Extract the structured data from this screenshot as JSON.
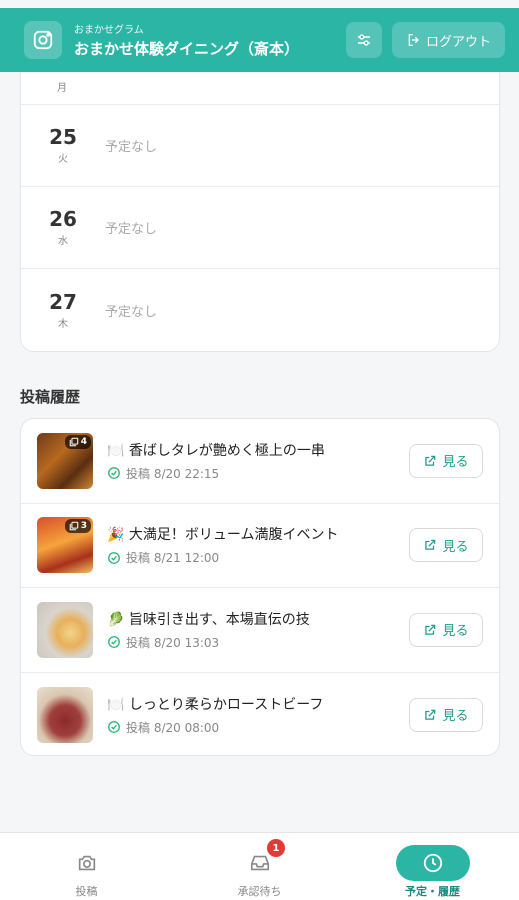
{
  "header": {
    "subtitle": "おまかせグラム",
    "title": "おまかせ体験ダイニング（斎本）",
    "logout_label": "ログアウト"
  },
  "calendar": {
    "partial_weekday": "月",
    "days": [
      {
        "day": "25",
        "weekday": "火",
        "status": "予定なし"
      },
      {
        "day": "26",
        "weekday": "水",
        "status": "予定なし"
      },
      {
        "day": "27",
        "weekday": "木",
        "status": "予定なし"
      }
    ]
  },
  "history": {
    "title": "投稿履歴",
    "view_label": "見る",
    "posts": [
      {
        "emoji": "🍽️",
        "title": "香ばしタレが艶めく極上の一串",
        "meta": "投稿 8/20 22:15",
        "image_count": "4"
      },
      {
        "emoji": "🎉",
        "title": "大満足！ボリューム満腹イベント",
        "meta": "投稿 8/21 12:00",
        "image_count": "3"
      },
      {
        "emoji": "🥬",
        "title": "旨味引き出す、本場直伝の技",
        "meta": "投稿 8/20 13:03",
        "image_count": ""
      },
      {
        "emoji": "🍽️",
        "title": "しっとり柔らかローストビーフ",
        "meta": "投稿 8/20 08:00",
        "image_count": ""
      }
    ]
  },
  "nav": {
    "items": [
      {
        "label": "投稿",
        "icon": "camera-icon"
      },
      {
        "label": "承認待ち",
        "icon": "inbox-icon",
        "badge": "1"
      },
      {
        "label": "予定・履歴",
        "icon": "clock-icon"
      }
    ]
  },
  "colors": {
    "brand": "#2bb5a5",
    "success": "#22b573",
    "badge": "#e53935"
  }
}
